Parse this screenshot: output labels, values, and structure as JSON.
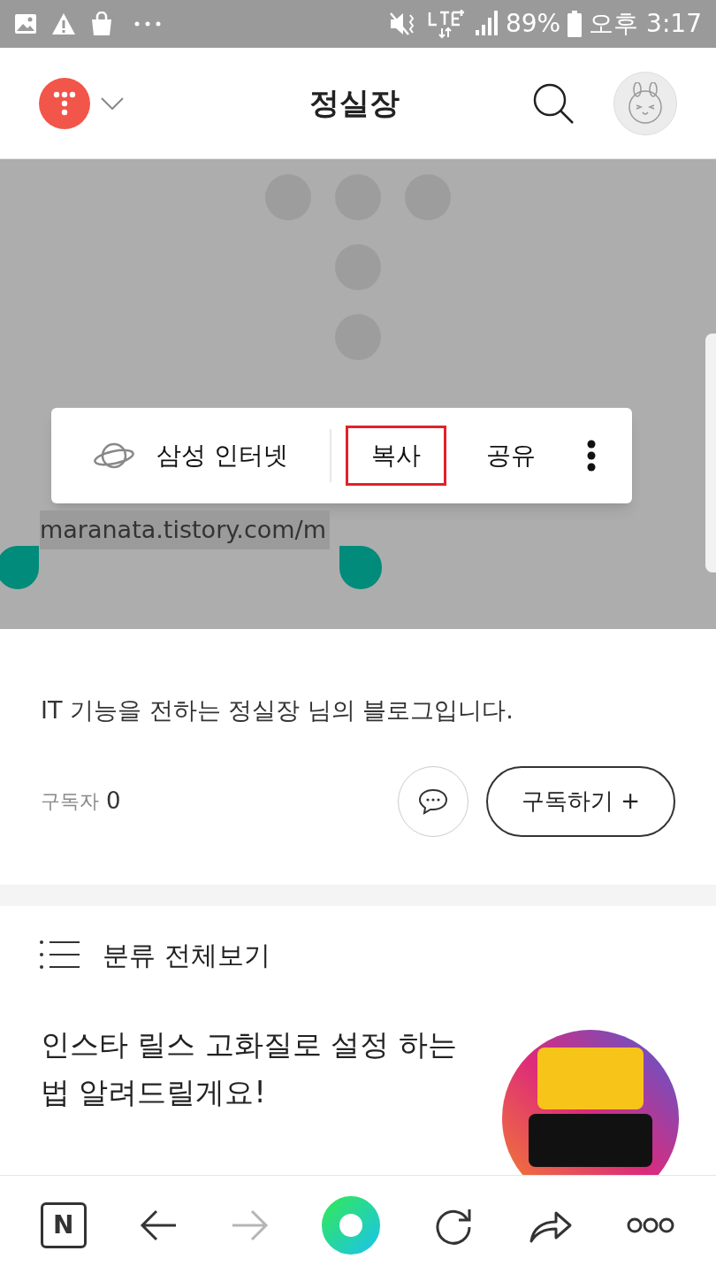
{
  "status_bar": {
    "battery": "89%",
    "time": "오후 3:17"
  },
  "header": {
    "title": "정실장"
  },
  "hero": {
    "url": "maranata.tistory.com/m"
  },
  "context_menu": {
    "items": [
      {
        "kind": "app",
        "label": "삼성 인터넷",
        "selected": false
      },
      {
        "kind": "action",
        "label": "복사",
        "selected": true
      },
      {
        "kind": "action",
        "label": "공유",
        "selected": false
      }
    ]
  },
  "blog": {
    "description": "IT 기능을 전하는 정실장 님의 블로그입니다.",
    "subscriber_label": "구독자",
    "subscriber_count": "0",
    "subscribe_button": "구독하기 +"
  },
  "category": {
    "label": "분류 전체보기"
  },
  "post": {
    "title": "인스타 릴스 고화질로 설정 하는법 알려드릴게요!"
  },
  "bottom_nav": [
    {
      "kind": "logo",
      "label": "N",
      "disabled": false
    },
    {
      "kind": "back",
      "disabled": false
    },
    {
      "kind": "forward",
      "disabled": true
    },
    {
      "kind": "home",
      "disabled": false
    },
    {
      "kind": "reload",
      "disabled": false
    },
    {
      "kind": "share",
      "disabled": false
    },
    {
      "kind": "more",
      "disabled": false
    }
  ]
}
